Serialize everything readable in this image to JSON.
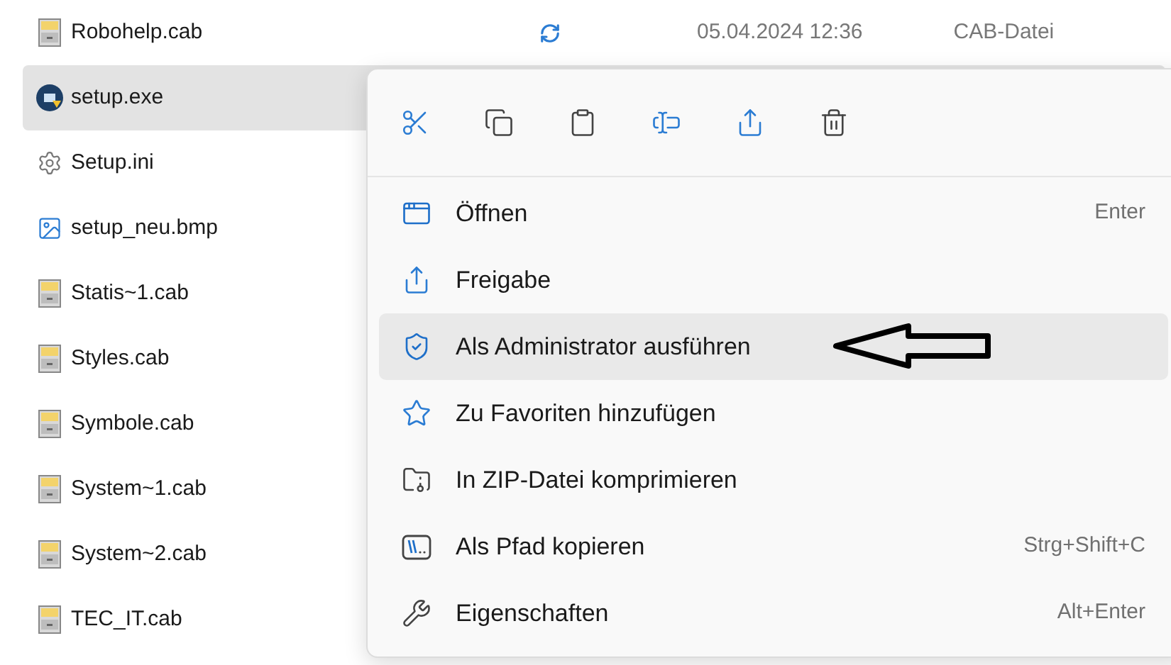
{
  "files": [
    {
      "name": "Robohelp.cab",
      "kind": "cab",
      "selected": false,
      "synced": true,
      "date": "05.04.2024 12:36",
      "type": "CAB-Datei"
    },
    {
      "name": "setup.exe",
      "kind": "exe",
      "selected": true
    },
    {
      "name": "Setup.ini",
      "kind": "ini",
      "selected": false
    },
    {
      "name": "setup_neu.bmp",
      "kind": "bmp",
      "selected": false
    },
    {
      "name": "Statis~1.cab",
      "kind": "cab",
      "selected": false
    },
    {
      "name": "Styles.cab",
      "kind": "cab",
      "selected": false
    },
    {
      "name": "Symbole.cab",
      "kind": "cab",
      "selected": false
    },
    {
      "name": "System~1.cab",
      "kind": "cab",
      "selected": false
    },
    {
      "name": "System~2.cab",
      "kind": "cab",
      "selected": false
    },
    {
      "name": "TEC_IT.cab",
      "kind": "cab",
      "selected": false
    }
  ],
  "context_menu": {
    "toolbar": [
      {
        "kind": "cut"
      },
      {
        "kind": "copy"
      },
      {
        "kind": "paste"
      },
      {
        "kind": "rename"
      },
      {
        "kind": "share"
      },
      {
        "kind": "delete"
      }
    ],
    "items": [
      {
        "kind": "open",
        "label": "Öffnen",
        "shortcut": "Enter",
        "selected": false
      },
      {
        "kind": "share",
        "label": "Freigabe",
        "selected": false
      },
      {
        "kind": "admin",
        "label": "Als Administrator ausführen",
        "selected": true
      },
      {
        "kind": "favorite",
        "label": "Zu Favoriten hinzufügen",
        "selected": false
      },
      {
        "kind": "zip",
        "label": "In ZIP-Datei komprimieren",
        "selected": false
      },
      {
        "kind": "path",
        "label": "Als Pfad kopieren",
        "shortcut": "Strg+Shift+C",
        "selected": false
      },
      {
        "kind": "properties",
        "label": "Eigenschaften",
        "shortcut": "Alt+Enter",
        "selected": false
      }
    ]
  }
}
